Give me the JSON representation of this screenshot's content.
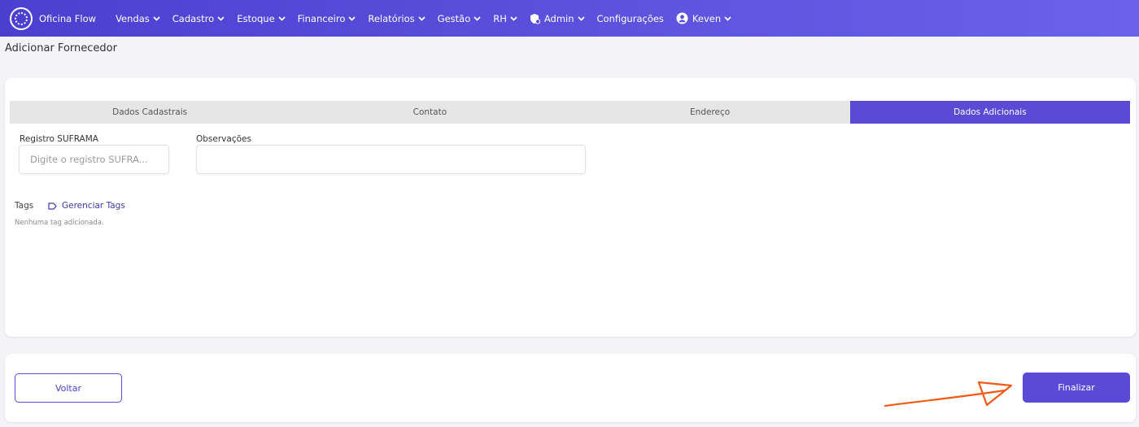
{
  "navbar": {
    "brand": "Oficina Flow",
    "items": [
      {
        "label": "Vendas"
      },
      {
        "label": "Cadastro"
      },
      {
        "label": "Estoque"
      },
      {
        "label": "Financeiro"
      },
      {
        "label": "Relatórios"
      },
      {
        "label": "Gestão"
      },
      {
        "label": "RH"
      },
      {
        "label": "Admin"
      },
      {
        "label": "Configurações"
      },
      {
        "label": "Keven"
      }
    ]
  },
  "page": {
    "title": "Adicionar Fornecedor"
  },
  "tabs": [
    {
      "label": "Dados Cadastrais",
      "active": false
    },
    {
      "label": "Contato",
      "active": false
    },
    {
      "label": "Endereço",
      "active": false
    },
    {
      "label": "Dados Adicionais",
      "active": true
    }
  ],
  "form": {
    "suframa": {
      "label": "Registro SUFRAMA",
      "placeholder": "Digite o registro SUFRA...",
      "value": ""
    },
    "observacoes": {
      "label": "Observações",
      "placeholder": "",
      "value": ""
    }
  },
  "tags": {
    "label": "Tags",
    "manage_label": "Gerenciar Tags",
    "empty_text": "Nenhuma tag adicionada."
  },
  "footer": {
    "back_label": "Voltar",
    "finish_label": "Finalizar"
  },
  "colors": {
    "accent": "#5b4ad6",
    "navbar_start": "#4b3fd0",
    "navbar_end": "#6a62ea",
    "annotation": "#f05a14"
  }
}
